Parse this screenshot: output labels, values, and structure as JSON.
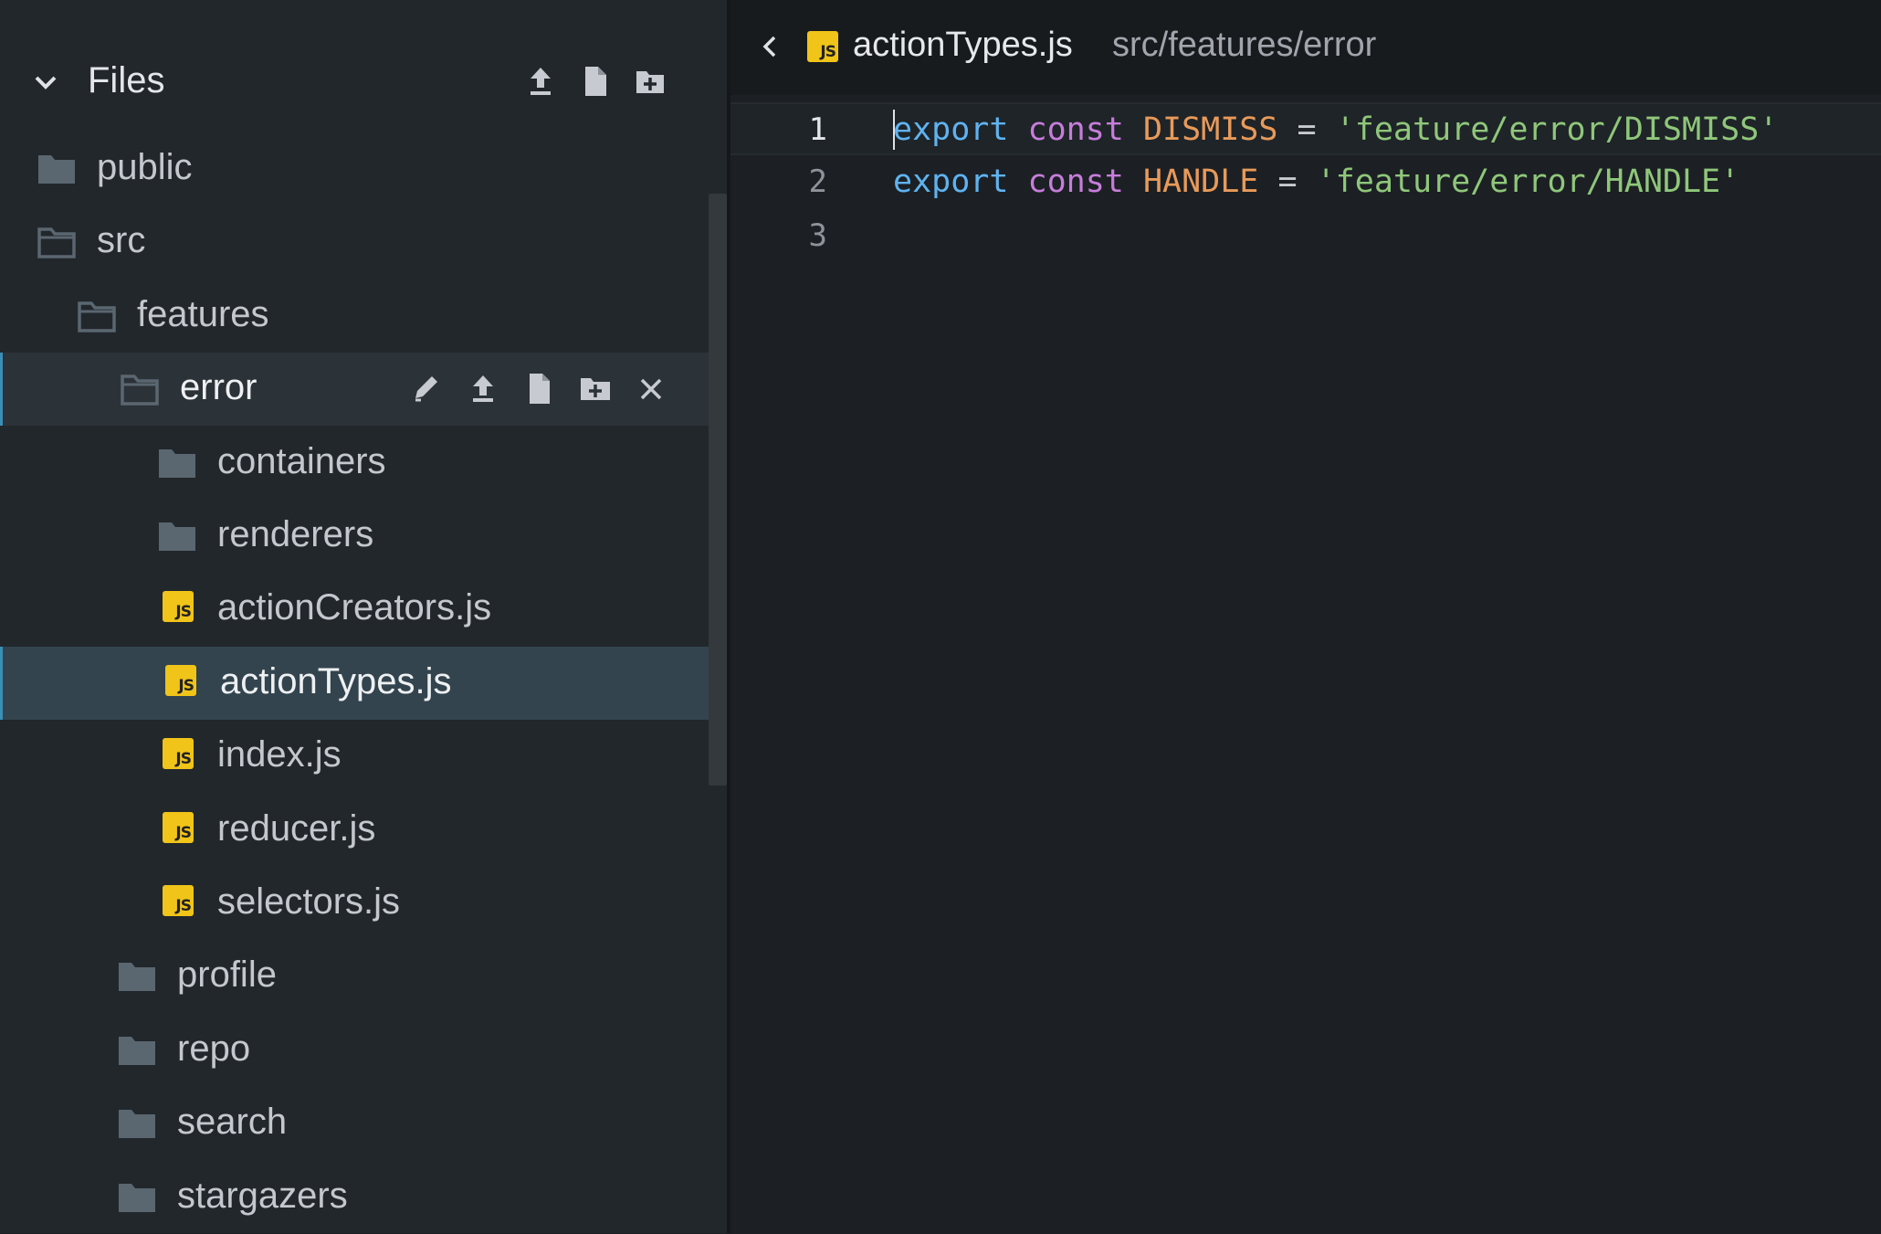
{
  "sidebar": {
    "title": "Files",
    "tree": [
      {
        "label": "public",
        "kind": "folder-closed",
        "depth": 0
      },
      {
        "label": "src",
        "kind": "folder-open",
        "depth": 0
      },
      {
        "label": "features",
        "kind": "folder-open",
        "depth": 1
      },
      {
        "label": "error",
        "kind": "folder-open",
        "depth": 2,
        "state": "hover"
      },
      {
        "label": "containers",
        "kind": "folder-closed",
        "depth": 3
      },
      {
        "label": "renderers",
        "kind": "folder-closed",
        "depth": 3
      },
      {
        "label": "actionCreators.js",
        "kind": "js",
        "depth": 3
      },
      {
        "label": "actionTypes.js",
        "kind": "js",
        "depth": 3,
        "state": "selected"
      },
      {
        "label": "index.js",
        "kind": "js",
        "depth": 3
      },
      {
        "label": "reducer.js",
        "kind": "js",
        "depth": 3
      },
      {
        "label": "selectors.js",
        "kind": "js",
        "depth": 3
      },
      {
        "label": "profile",
        "kind": "folder-closed",
        "depth": 2
      },
      {
        "label": "repo",
        "kind": "folder-closed",
        "depth": 2
      },
      {
        "label": "search",
        "kind": "folder-closed",
        "depth": 2
      },
      {
        "label": "stargazers",
        "kind": "folder-closed",
        "depth": 2
      }
    ],
    "js_badge": "JS"
  },
  "editor": {
    "tab_name": "actionTypes.js",
    "tab_path": "src/features/error",
    "lines": [
      {
        "n": "1",
        "tokens": [
          [
            "export",
            "kw-export"
          ],
          [
            " ",
            "op"
          ],
          [
            "const",
            "kw-const"
          ],
          [
            " ",
            "op"
          ],
          [
            "DISMISS",
            "ident"
          ],
          [
            " = ",
            "op"
          ],
          [
            "'feature/error/DISMISS'",
            "str"
          ]
        ]
      },
      {
        "n": "2",
        "tokens": [
          [
            "export",
            "kw-export"
          ],
          [
            " ",
            "op"
          ],
          [
            "const",
            "kw-const"
          ],
          [
            " ",
            "op"
          ],
          [
            "HANDLE",
            "ident"
          ],
          [
            " = ",
            "op"
          ],
          [
            "'feature/error/HANDLE'",
            "str"
          ]
        ]
      },
      {
        "n": "3",
        "tokens": []
      }
    ]
  },
  "colors": {
    "accent": "#3a8fb7",
    "js_yellow": "#f0c419",
    "folder_icon": "#5a6670"
  }
}
